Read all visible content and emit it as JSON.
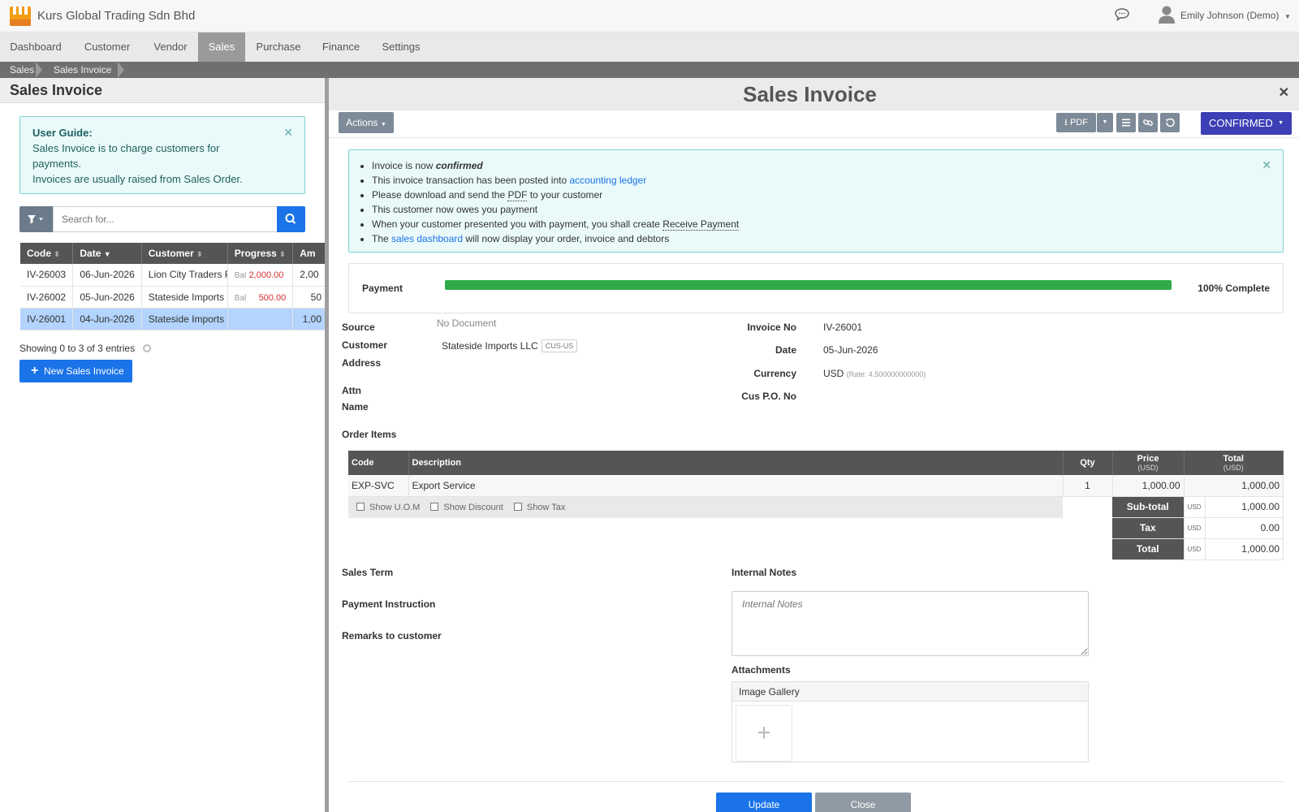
{
  "app": {
    "company_name": "Kurs Global Trading Sdn Bhd",
    "user_name": "Emily Johnson (Demo)"
  },
  "nav": {
    "items": [
      "Dashboard",
      "Customer",
      "Vendor",
      "Sales",
      "Purchase",
      "Finance",
      "Settings"
    ],
    "active": "Sales"
  },
  "breadcrumb": [
    "Sales",
    "Sales Invoice"
  ],
  "list_panel": {
    "title": "Sales Invoice",
    "guide_title": "User Guide:",
    "guide_line1": "Sales Invoice is to charge customers for payments.",
    "guide_line2": "Invoices are usually raised from Sales Order.",
    "search_placeholder": "Search for...",
    "columns": [
      "Code",
      "Date",
      "Customer",
      "Progress",
      "Am"
    ],
    "rows": [
      {
        "code": "IV-26003",
        "date": "06-Jun-2026",
        "customer": "Lion City Traders P",
        "bal_label": "Bal",
        "balance": "2,000.00",
        "amount": "2,00"
      },
      {
        "code": "IV-26002",
        "date": "05-Jun-2026",
        "customer": "Stateside Imports I",
        "bal_label": "Bal",
        "balance": "500.00",
        "amount": "50"
      },
      {
        "code": "IV-26001",
        "date": "04-Jun-2026",
        "customer": "Stateside Imports I",
        "bal_label": "",
        "balance": "",
        "amount": "1,00"
      }
    ],
    "showing_text": "Showing 0 to 3 of 3 entries",
    "new_button": "New Sales Invoice"
  },
  "detail": {
    "title": "Sales Invoice",
    "actions_label": "Actions",
    "pdf_label": "PDF",
    "status_label": "CONFIRMED",
    "notice": {
      "l1_pre": "Invoice is now ",
      "l1_em": "confirmed",
      "l2_pre": "This invoice transaction has been posted into ",
      "l2_link": "accounting ledger",
      "l3_pre": "Please download and send the ",
      "l3_link": "PDF",
      "l3_post": " to your customer",
      "l4": "This customer now owes you payment",
      "l5_pre": "When your customer presented you with payment, you shall create ",
      "l5_link": "Receive Payment",
      "l6_pre": "The ",
      "l6_link": "sales dashboard",
      "l6_post": " will now display your order, invoice and debtors"
    },
    "payment": {
      "label": "Payment",
      "progress": 1.0,
      "progress_text": "100% Complete"
    },
    "fields": {
      "source_label": "Source",
      "source_value": "No Document",
      "customer_label": "Customer",
      "customer_value": "Stateside Imports LLC",
      "customer_code": "CUS-US",
      "address_label": "Address",
      "attn_label": "Attn",
      "name_label": "Name",
      "invoice_no_label": "Invoice No",
      "invoice_no_value": "IV-26001",
      "date_label": "Date",
      "date_value": "05-Jun-2026",
      "currency_label": "Currency",
      "currency_value": "USD",
      "currency_rate": "(Rate: 4.500000000000)",
      "cus_po_label": "Cus P.O. No"
    },
    "order_items": {
      "title": "Order Items",
      "col_code": "Code",
      "col_desc": "Description",
      "col_qty": "Qty",
      "col_price": "Price",
      "col_price_sub": "(USD)",
      "col_total": "Total",
      "col_total_sub": "(USD)",
      "items": [
        {
          "code": "EXP-SVC",
          "description": "Export Service",
          "qty": "1",
          "price": "1,000.00",
          "total": "1,000.00"
        }
      ],
      "opt_uom": "Show U.O.M",
      "opt_discount": "Show Discount",
      "opt_tax": "Show Tax",
      "subtotal_label": "Sub-total",
      "subtotal_cur": "USD",
      "subtotal": "1,000.00",
      "tax_label": "Tax",
      "tax_cur": "USD",
      "tax": "0.00",
      "total_label": "Total",
      "total_cur": "USD",
      "total": "1,000.00"
    },
    "sales_term_label": "Sales Term",
    "payment_instruction_label": "Payment Instruction",
    "remarks_label": "Remarks to customer",
    "internal_notes_label": "Internal Notes",
    "internal_notes_placeholder": "Internal Notes",
    "attachments_label": "Attachments",
    "gallery_label": "Image Gallery",
    "update_button": "Update",
    "close_button": "Close"
  },
  "colors": {
    "primary": "#1a73e8",
    "confirmed": "#3c3fb5",
    "progress": "#2eaa4a",
    "info_bg": "#eafafa",
    "header_dark": "#555555"
  }
}
